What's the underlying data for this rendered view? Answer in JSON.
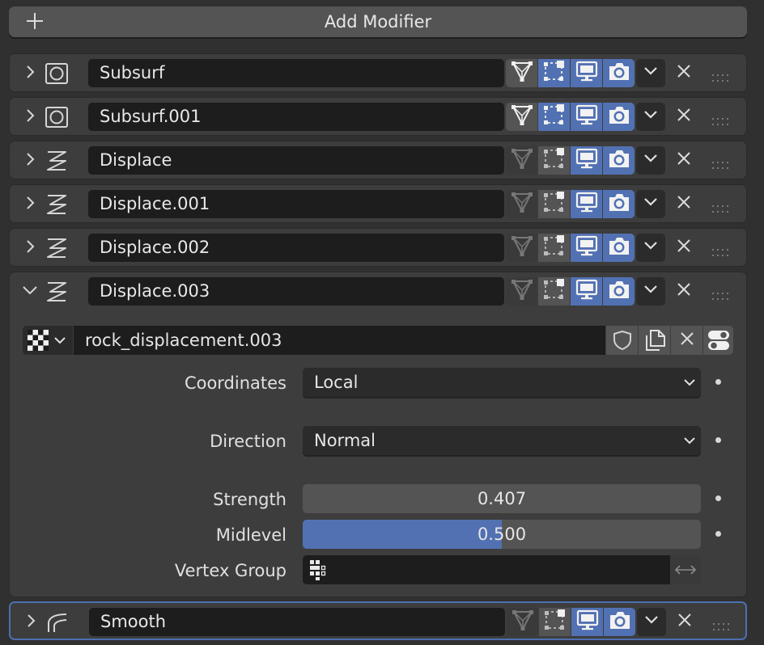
{
  "add_modifier_label": "Add Modifier",
  "modifiers": [
    {
      "name": "Subsurf",
      "type_icon": "subsurf-circle-icon",
      "edit_cage": "on",
      "edit_mode": "on",
      "viewport": "on",
      "render": "on",
      "expanded": false
    },
    {
      "name": "Subsurf.001",
      "type_icon": "subsurf-circle-icon",
      "edit_cage": "on",
      "edit_mode": "on",
      "viewport": "on",
      "render": "on",
      "expanded": false
    },
    {
      "name": "Displace",
      "type_icon": "displace-icon",
      "edit_cage": "off",
      "edit_mode": "off",
      "viewport": "on",
      "render": "on",
      "expanded": false
    },
    {
      "name": "Displace.001",
      "type_icon": "displace-icon",
      "edit_cage": "off",
      "edit_mode": "off",
      "viewport": "on",
      "render": "on",
      "expanded": false
    },
    {
      "name": "Displace.002",
      "type_icon": "displace-icon",
      "edit_cage": "off",
      "edit_mode": "off",
      "viewport": "on",
      "render": "on",
      "expanded": false
    },
    {
      "name": "Displace.003",
      "type_icon": "displace-icon",
      "edit_cage": "off",
      "edit_mode": "off",
      "viewport": "on",
      "render": "on",
      "expanded": true
    },
    {
      "name": "Smooth",
      "type_icon": "smooth-icon",
      "edit_cage": "off",
      "edit_mode": "off",
      "viewport": "on",
      "render": "on",
      "expanded": false
    }
  ],
  "displace": {
    "texture_name": "rock_displacement.003",
    "coordinates_label": "Coordinates",
    "coordinates_value": "Local",
    "direction_label": "Direction",
    "direction_value": "Normal",
    "strength_label": "Strength",
    "strength_value": "0.407",
    "midlevel_label": "Midlevel",
    "midlevel_value": "0.500",
    "midlevel_fraction": 0.5,
    "vertex_group_label": "Vertex Group",
    "vertex_group_value": ""
  },
  "colors": {
    "panel_bg": "#3d3d3d",
    "active_blue": "#5271b3",
    "field_bg": "#1d1d1d",
    "active_outline": "#4d6fb0"
  }
}
